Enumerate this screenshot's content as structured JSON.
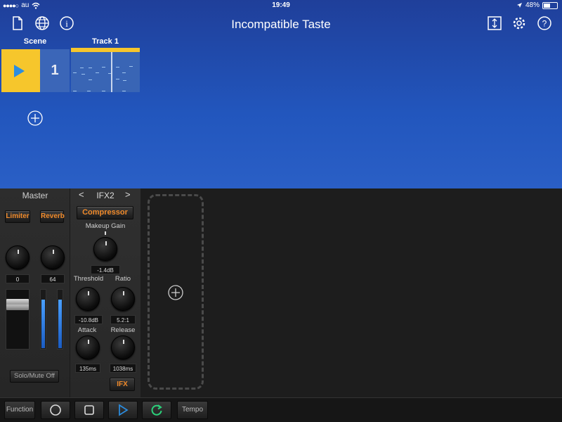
{
  "statusbar": {
    "carrier": "au",
    "time": "19:49",
    "battery": "48%"
  },
  "navbar": {
    "title": "Incompatible Taste"
  },
  "grid": {
    "scene_header": "Scene",
    "track_header": "Track 1",
    "scene_number": "1"
  },
  "master": {
    "title": "Master",
    "limiter_label": "Limiter",
    "reverb_label": "Reverb",
    "knob1_value": "0",
    "knob2_value": "64",
    "solo_label": "Solo/Mute Off"
  },
  "ifx": {
    "prev": "<",
    "title": "IFX2",
    "next": ">",
    "effect_label": "Compressor",
    "makeup_label": "Makeup Gain",
    "makeup_value": "-1.4dB",
    "threshold_label": "Threshold",
    "threshold_value": "-10.8dB",
    "ratio_label": "Ratio",
    "ratio_value": "5.2:1",
    "attack_label": "Attack",
    "attack_value": "135ms",
    "release_label": "Release",
    "release_value": "1038ms",
    "ifx_button": "IFX"
  },
  "footer": {
    "function_label": "Function",
    "tempo_label": "Tempo"
  },
  "colors": {
    "accent_yellow": "#f6c62c",
    "play_blue": "#2b8de0",
    "orange": "#f08a2a",
    "loop_green": "#2bd07a"
  }
}
